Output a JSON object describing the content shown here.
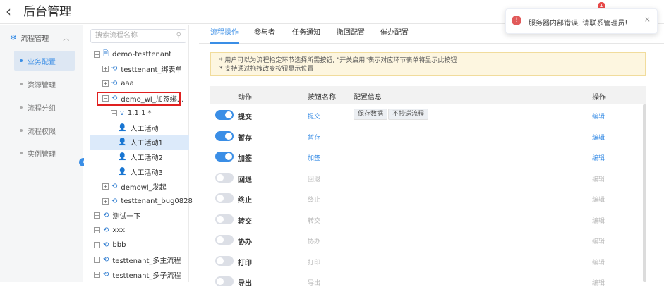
{
  "header": {
    "back_glyph": "‹",
    "title": "后台管理",
    "notification_count": "1"
  },
  "toast": {
    "message": "服务器内部错误, 请联系管理员!",
    "close_glyph": "×"
  },
  "nav": {
    "group_label": "流程管理",
    "items": [
      {
        "label": "业务配置",
        "active": true
      },
      {
        "label": "资源管理"
      },
      {
        "label": "流程分组"
      },
      {
        "label": "流程权限"
      },
      {
        "label": "实例管理"
      }
    ]
  },
  "tree": {
    "search_placeholder": "搜索流程名称",
    "nodes": [
      {
        "label": "demo-testtenant",
        "expander": "−",
        "icon": "doc-icon"
      },
      {
        "label": "testtenant_绑表单",
        "expander": "+",
        "icon": "flow-icon"
      },
      {
        "label": "aaa",
        "expander": "+",
        "icon": "flow-icon"
      },
      {
        "label": "demo_wl_加签绑...",
        "expander": "−",
        "icon": "flow-icon"
      },
      {
        "label": "1.1.1 *",
        "expander": "−",
        "icon": "version-icon"
      },
      {
        "label": "人工活动",
        "icon": "user-icon"
      },
      {
        "label": "人工活动1",
        "icon": "user-icon",
        "selected": true
      },
      {
        "label": "人工活动2",
        "icon": "user-icon"
      },
      {
        "label": "人工活动3",
        "icon": "user-icon"
      },
      {
        "label": "demowl_发起",
        "expander": "+",
        "icon": "flow-icon"
      },
      {
        "label": "testtenant_bug0828",
        "expander": "+",
        "icon": "flow-icon"
      },
      {
        "label": "测试一下",
        "expander": "+",
        "icon": "flow-icon"
      },
      {
        "label": "xxx",
        "expander": "+",
        "icon": "flow-icon"
      },
      {
        "label": "bbb",
        "expander": "+",
        "icon": "flow-icon"
      },
      {
        "label": "testtenant_多主流程",
        "expander": "+",
        "icon": "flow-icon"
      },
      {
        "label": "testtenant_多子流程",
        "expander": "+",
        "icon": "flow-icon"
      }
    ]
  },
  "tabs": [
    {
      "label": "流程操作",
      "active": true
    },
    {
      "label": "参与者"
    },
    {
      "label": "任务通知"
    },
    {
      "label": "撤回配置"
    },
    {
      "label": "催办配置"
    }
  ],
  "notice": {
    "line1": "* 用户可以为流程指定环节选择所需按钮, \"开关启用\"表示对应环节表单将显示此按钮",
    "line2": "* 支持通过拖拽改变按钮显示位置"
  },
  "table": {
    "headers": {
      "action": "动作",
      "button_name": "按钮名称",
      "config": "配置信息",
      "op": "操作"
    },
    "rows": [
      {
        "name": "提交",
        "button": "提交",
        "enabled": true,
        "tags": [
          "保存数据",
          "不抄送流程"
        ],
        "edit": "编辑"
      },
      {
        "name": "暂存",
        "button": "暂存",
        "enabled": true,
        "tags": [],
        "edit": "编辑"
      },
      {
        "name": "加签",
        "button": "加签",
        "enabled": true,
        "tags": [],
        "edit": "编辑"
      },
      {
        "name": "回退",
        "button": "回退",
        "enabled": false,
        "tags": [],
        "edit": "编辑"
      },
      {
        "name": "终止",
        "button": "终止",
        "enabled": false,
        "tags": [],
        "edit": "编辑"
      },
      {
        "name": "转交",
        "button": "转交",
        "enabled": false,
        "tags": [],
        "edit": "编辑"
      },
      {
        "name": "协办",
        "button": "协办",
        "enabled": false,
        "tags": [],
        "edit": "编辑"
      },
      {
        "name": "打印",
        "button": "打印",
        "enabled": false,
        "tags": [],
        "edit": "编辑"
      },
      {
        "name": "导出",
        "button": "导出",
        "enabled": false,
        "tags": [],
        "edit": "编辑"
      }
    ]
  },
  "colors": {
    "accent": "#3a8ee6",
    "error": "#e15a5a",
    "notice_bg": "#fdf6e0"
  }
}
